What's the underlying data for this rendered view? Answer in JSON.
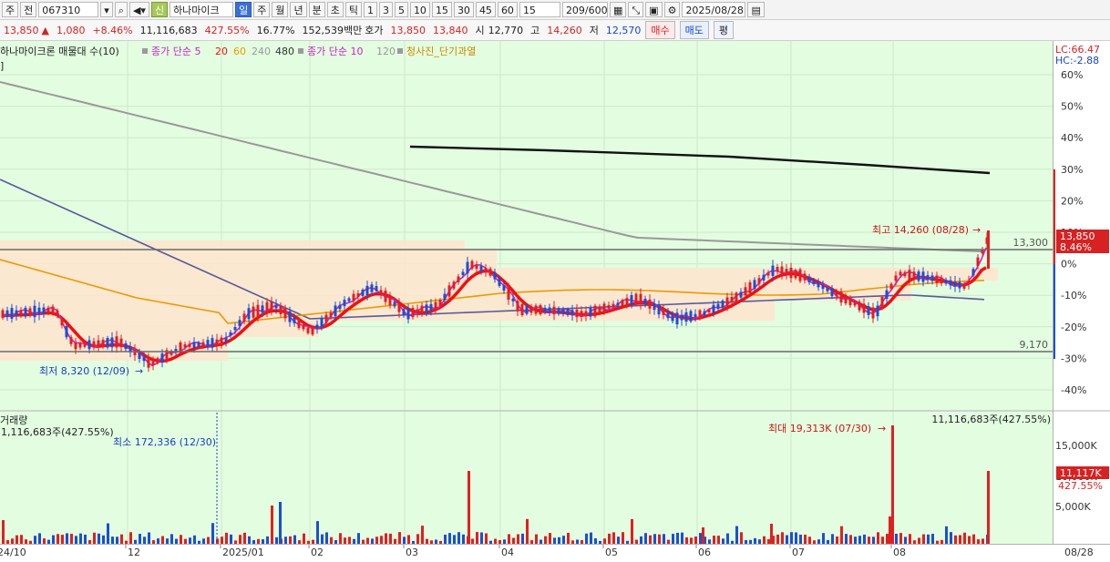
{
  "toolbar": {
    "kind_label": "주",
    "prev_label": "전",
    "code_value": "067310",
    "stock_name": "하나마이크",
    "badge_new": "신",
    "periods": [
      "일",
      "주",
      "월",
      "년",
      "분",
      "초",
      "틱"
    ],
    "minute_options": [
      "1",
      "3",
      "5",
      "10",
      "15",
      "30",
      "45",
      "60"
    ],
    "period_value": "15",
    "count_value": "209/600",
    "date_value": "2025/08/28"
  },
  "quote": {
    "price": "13,850",
    "arrow": "▲",
    "change": "1,080",
    "change_pct": "+8.46%",
    "volume": "11,116,683",
    "volume_ratio": "427.55%",
    "turnover": "16.77%",
    "amount": "152,539백만",
    "ask_label": "호가",
    "ask": "13,850",
    "bid": "13,840",
    "open_label": "시",
    "open": "12,770",
    "high_label": "고",
    "high": "14,260",
    "low_label": "저",
    "low": "12,570",
    "buy_label": "매수",
    "sell_label": "매도",
    "flat_label": "평"
  },
  "legend": {
    "title": "하나마이크론 매물대 수(10)",
    "ma1_label": "종가 단순 5",
    "ma1_periods": [
      "20",
      "60",
      "240",
      "480"
    ],
    "ma2_label": "종가 단순 10",
    "ma2_periods": [
      "120"
    ],
    "signal_label": "청사진_단기과열"
  },
  "price_panel": {
    "lc_label": "LC:66.47",
    "hc_label": "HC:-2.88",
    "percent_ticks": [
      "60%",
      "50%",
      "40%",
      "30%",
      "20%",
      "10%",
      "0%",
      "-10%",
      "-20%",
      "-30%",
      "-40%"
    ],
    "high_marker": "최고 14,260 (08/28)",
    "low_marker": "최저 8,320 (12/09)",
    "line_upper_label": "13,300",
    "line_lower_label": "9,170",
    "current_price": "13,850",
    "current_pct": "8.46%"
  },
  "volume_panel": {
    "title": "거래량",
    "value_label": "11,116,683주(427.55%)",
    "value_label_right": "11,116,683주(427.55%)",
    "min_marker": "최소 172,336 (12/30)",
    "max_marker": "최대 19,313K (07/30)",
    "ticks": [
      "15,000K",
      "10,000K",
      "5,000K"
    ],
    "current_volume": "11,117K",
    "current_pct": "427.55%"
  },
  "x_axis": {
    "labels": [
      "24/10",
      "12",
      "2025/01",
      "02",
      "03",
      "04",
      "05",
      "06",
      "07",
      "08"
    ],
    "right_label": "08/28"
  },
  "colors": {
    "chart_bg": "#e3fde0",
    "up": "#e02020",
    "down": "#1a50d0",
    "ma5": "#cc22cc",
    "ma20": "#ee1111",
    "ma60": "#ee9900",
    "ma240": "#999999",
    "ma480": "#5a5a9a",
    "ma_black": "#111111"
  },
  "chart_data": {
    "type": "candlestick",
    "price_axis": {
      "upper_line": 13300,
      "lower_line": 9170,
      "high": 14260,
      "low": 8320,
      "last": 13850
    },
    "volume_axis": {
      "ticks": [
        15000,
        10000,
        5000
      ],
      "unit": "K",
      "max": 19313,
      "last": 11117
    },
    "x_labels": [
      "24/10",
      "12",
      "2025/01",
      "02",
      "03",
      "04",
      "05",
      "06",
      "07",
      "08",
      "08/28"
    ]
  }
}
